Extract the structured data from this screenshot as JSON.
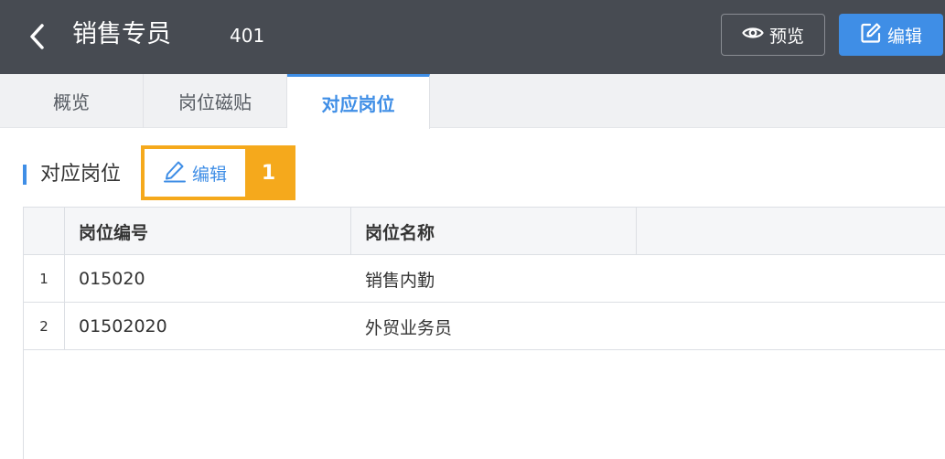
{
  "header": {
    "title": "销售专员",
    "code": "401",
    "preview_label": "预览",
    "edit_label": "编辑"
  },
  "tabs": [
    {
      "label": "概览"
    },
    {
      "label": "岗位磁贴"
    },
    {
      "label": "对应岗位",
      "active": true
    }
  ],
  "section": {
    "title": "对应岗位",
    "edit_label": "编辑",
    "callout_number": "1"
  },
  "table": {
    "columns": [
      "岗位编号",
      "岗位名称"
    ],
    "rows": [
      {
        "index": "1",
        "code": "015020",
        "name": "销售内勤"
      },
      {
        "index": "2",
        "code": "01502020",
        "name": "外贸业务员"
      }
    ]
  },
  "colors": {
    "header_bg": "#474b52",
    "accent": "#3f8ee6",
    "callout": "#f5a91c"
  }
}
